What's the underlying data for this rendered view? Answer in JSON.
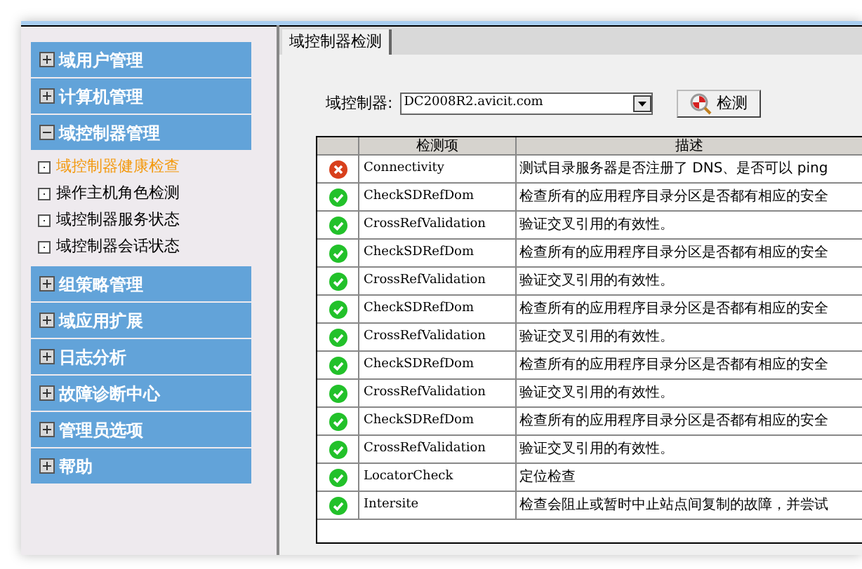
{
  "sidebar": {
    "groups": [
      {
        "label": "域用户管理",
        "expanded": false
      },
      {
        "label": "计算机管理",
        "expanded": false
      },
      {
        "label": "域控制器管理",
        "expanded": true,
        "children": [
          {
            "label": "域控制器健康检查",
            "selected": true
          },
          {
            "label": "操作主机角色检测",
            "selected": false
          },
          {
            "label": "域控制器服务状态",
            "selected": false
          },
          {
            "label": "域控制器会话状态",
            "selected": false
          }
        ]
      },
      {
        "label": "组策略管理",
        "expanded": false
      },
      {
        "label": "域应用扩展",
        "expanded": false
      },
      {
        "label": "日志分析",
        "expanded": false
      },
      {
        "label": "故障诊断中心",
        "expanded": false
      },
      {
        "label": "管理员选项",
        "expanded": false
      },
      {
        "label": "帮助",
        "expanded": false
      }
    ]
  },
  "tabs": [
    {
      "label": "域控制器检测",
      "selected": true
    }
  ],
  "controller": {
    "label": "域控制器:",
    "value": "DC2008R2.avicit.com",
    "button": "检测"
  },
  "table": {
    "columns": [
      "检测项",
      "描述"
    ],
    "rows": [
      {
        "passed": false,
        "name": "Connectivity",
        "description": "测试目录服务器是否注册了 DNS、是否可以 ping"
      },
      {
        "passed": true,
        "name": "CheckSDRefDom",
        "description": "检查所有的应用程序目录分区是否都有相应的安全"
      },
      {
        "passed": true,
        "name": "CrossRefValidation",
        "description": "验证交叉引用的有效性。"
      },
      {
        "passed": true,
        "name": "CheckSDRefDom",
        "description": "检查所有的应用程序目录分区是否都有相应的安全"
      },
      {
        "passed": true,
        "name": "CrossRefValidation",
        "description": "验证交叉引用的有效性。"
      },
      {
        "passed": true,
        "name": "CheckSDRefDom",
        "description": "检查所有的应用程序目录分区是否都有相应的安全"
      },
      {
        "passed": true,
        "name": "CrossRefValidation",
        "description": "验证交叉引用的有效性。"
      },
      {
        "passed": true,
        "name": "CheckSDRefDom",
        "description": "检查所有的应用程序目录分区是否都有相应的安全"
      },
      {
        "passed": true,
        "name": "CrossRefValidation",
        "description": "验证交叉引用的有效性。"
      },
      {
        "passed": true,
        "name": "CheckSDRefDom",
        "description": "检查所有的应用程序目录分区是否都有相应的安全"
      },
      {
        "passed": true,
        "name": "CrossRefValidation",
        "description": "验证交叉引用的有效性。"
      },
      {
        "passed": true,
        "name": "LocatorCheck",
        "description": "定位检查"
      },
      {
        "passed": true,
        "name": "Intersite",
        "description": "检查会阻止或暂时中止站点间复制的故障，并尝试"
      }
    ]
  }
}
